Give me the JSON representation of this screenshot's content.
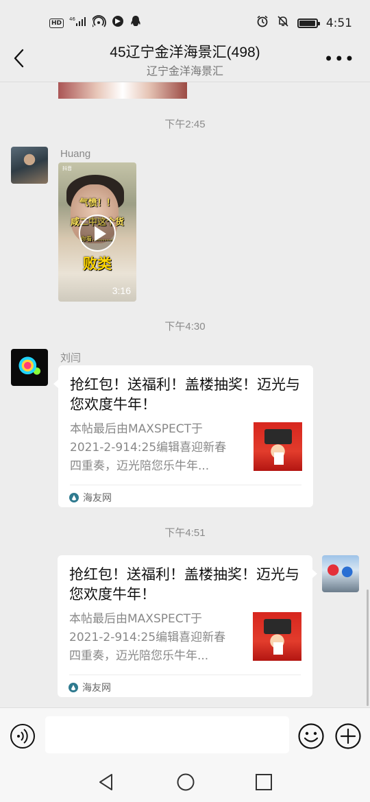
{
  "status_bar": {
    "hd_label": "HD",
    "network_label": "46",
    "time": "4:51",
    "battery_level": 0.9,
    "icons": [
      "hd-icon",
      "signal-icon",
      "hotspot-icon",
      "app-notification-icon",
      "qq-icon",
      "alarm-icon",
      "mute-icon",
      "battery-icon"
    ]
  },
  "header": {
    "title": "45辽宁金洋海景汇(498)",
    "subtitle": "辽宁金洋海景汇",
    "back_icon": "chevron-left-icon",
    "more_label": "•••"
  },
  "messages": {
    "ts1": "下午2:45",
    "ts2": "下午4:30",
    "ts3": "下午4:51",
    "video": {
      "sender": "Huang",
      "duration": "3:16",
      "caption_1": "气愤！！",
      "caption_2": "咸二中这个货",
      "caption_3": "你看…………",
      "caption_4": "败类",
      "watermark": "抖音"
    },
    "card1": {
      "sender": "刘闫",
      "title": "抢红包！送福利！盖楼抽奖！迈光与您欢度牛年！",
      "desc_line1": "本帖最后由MAXSPECT于",
      "desc_line2": "2021-2-914:25编辑喜迎新春",
      "desc_line3": "四重奏，迈光陪您乐牛年...",
      "source": "海友网"
    },
    "card2": {
      "title": "抢红包！送福利！盖楼抽奖！迈光与您欢度牛年！",
      "desc_line1": "本帖最后由MAXSPECT于",
      "desc_line2": "2021-2-914:25编辑喜迎新春",
      "desc_line3": "四重奏，迈光陪您乐牛年...",
      "source": "海友网"
    }
  },
  "input_bar": {
    "text_value": "",
    "icons": [
      "voice-icon",
      "emoji-icon",
      "plus-icon"
    ]
  },
  "nav_bar": {
    "icons": [
      "nav-back-icon",
      "nav-home-icon",
      "nav-recent-icon"
    ]
  },
  "colors": {
    "background": "#ededed",
    "bubble": "#ffffff",
    "timestamp": "#8a8a8a"
  }
}
